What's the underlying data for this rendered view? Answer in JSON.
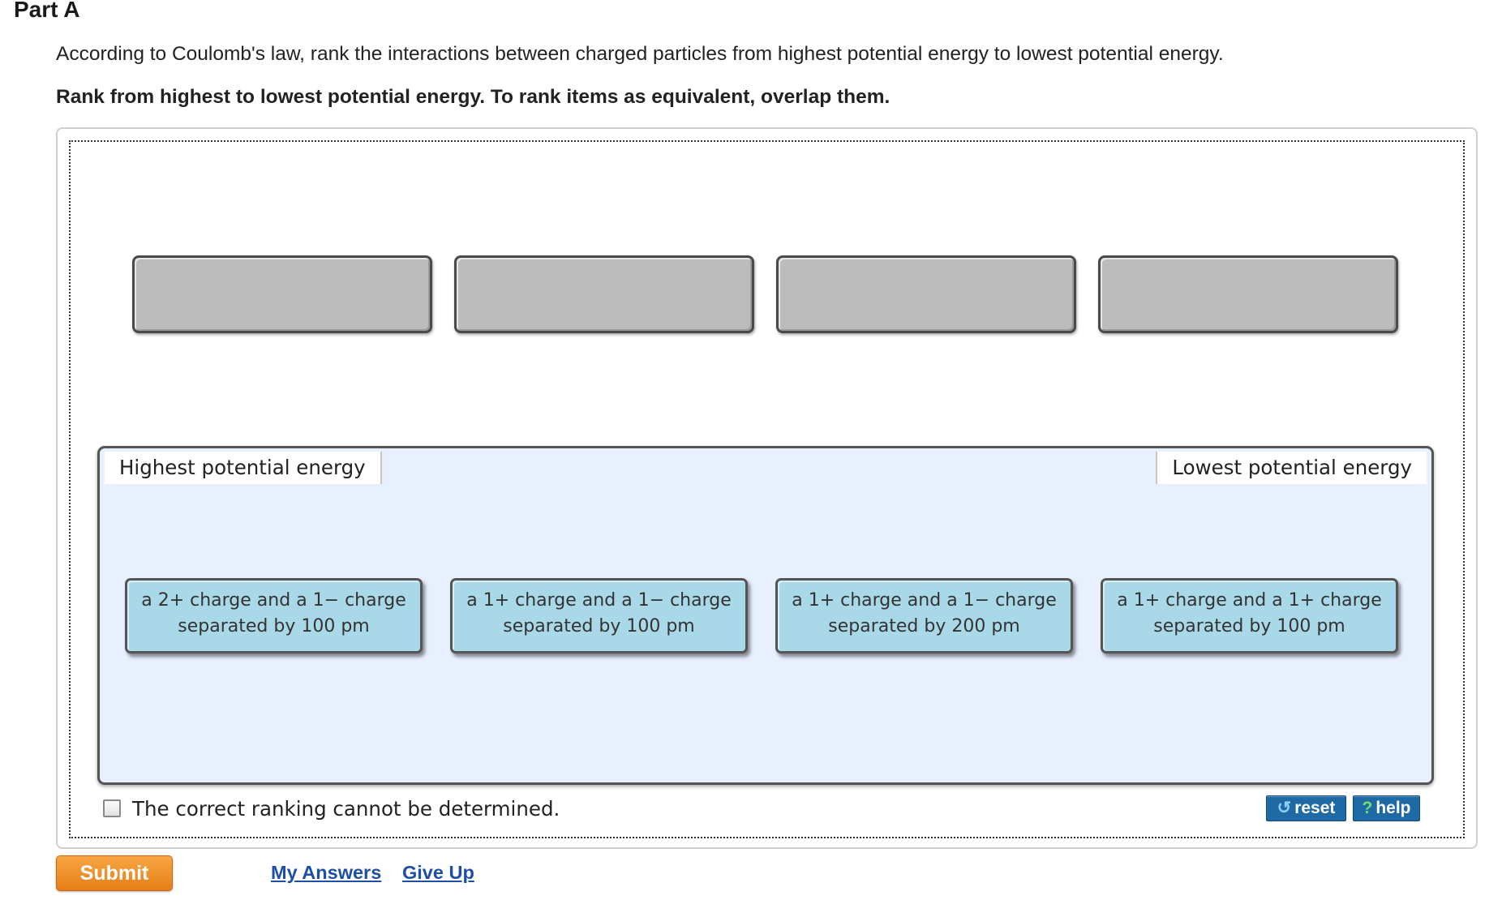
{
  "part": {
    "title": "Part A"
  },
  "question": {
    "text": "According to Coulomb's law, rank the interactions between charged particles from highest potential energy to lowest potential energy.",
    "instruction": "Rank from highest to lowest potential energy. To rank items as equivalent, overlap them."
  },
  "ranking": {
    "left_label": "Highest potential energy",
    "right_label": "Lowest potential energy",
    "items": [
      {
        "line1": "a 2+ charge and a 1− charge",
        "line2": "separated by 100 pm"
      },
      {
        "line1": "a 1+ charge and a 1− charge",
        "line2": "separated by 100 pm"
      },
      {
        "line1": "a 1+ charge and a 1− charge",
        "line2": "separated by 200 pm"
      },
      {
        "line1": "a 1+ charge and a 1+ charge",
        "line2": "separated by 100 pm"
      }
    ],
    "cannot_determine_label": "The correct ranking cannot be determined.",
    "cannot_determine_checked": false
  },
  "controls": {
    "reset_label": "reset",
    "help_label": "help",
    "reset_icon": "↺",
    "help_icon": "?",
    "submit_label": "Submit",
    "my_answers_label": "My Answers",
    "give_up_label": "Give Up"
  }
}
